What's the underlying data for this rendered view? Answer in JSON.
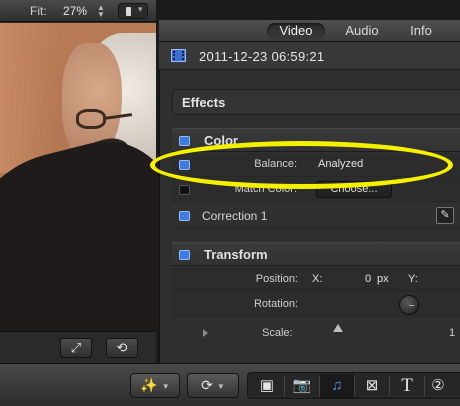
{
  "viewer": {
    "fit_label": "Fit:",
    "fit_value": "27%",
    "view_icon": "view-options-icon",
    "bottom_buttons": [
      {
        "name": "fullscreen-icon",
        "glyph": "⤢"
      },
      {
        "name": "loop-icon",
        "glyph": "⟲"
      }
    ]
  },
  "inspector": {
    "tabs": [
      {
        "label": "Video",
        "selected": true
      },
      {
        "label": "Audio",
        "selected": false
      },
      {
        "label": "Info",
        "selected": false
      }
    ],
    "clip_icon": "film-icon",
    "clip_date": "2011-12-23 06:59:21",
    "effects_title": "Effects",
    "color": {
      "title": "Color",
      "balance_label": "Balance:",
      "balance_value": "Analyzed",
      "match_color_label": "Match Color:",
      "choose_button": "Choose...",
      "correction_label": "Correction 1"
    },
    "transform": {
      "title": "Transform",
      "position_label": "Position:",
      "x_label": "X:",
      "x_value": "0",
      "x_unit": "px",
      "y_label": "Y:",
      "rotation_label": "Rotation:",
      "scale_label": "Scale:",
      "scale_end": "1"
    }
  },
  "toolbar": {
    "buttons": [
      {
        "name": "enhance-wand-icon",
        "glyph": "✨"
      },
      {
        "name": "retime-icon",
        "glyph": "⟳"
      }
    ],
    "browsers": [
      {
        "name": "effects-browser-icon",
        "glyph": "▣",
        "active": false
      },
      {
        "name": "photo-browser-icon",
        "glyph": "📷",
        "active": false
      },
      {
        "name": "music-browser-icon",
        "glyph": "♫",
        "active": true
      },
      {
        "name": "transitions-browser-icon",
        "glyph": "⊠",
        "active": false
      },
      {
        "name": "titles-browser-icon",
        "glyph": "T",
        "active": false
      },
      {
        "name": "generators-browser-icon",
        "glyph": "②",
        "active": false
      }
    ]
  },
  "colors": {
    "accent_blue": "#3b7be4",
    "highlight_yellow": "#f5f000"
  }
}
